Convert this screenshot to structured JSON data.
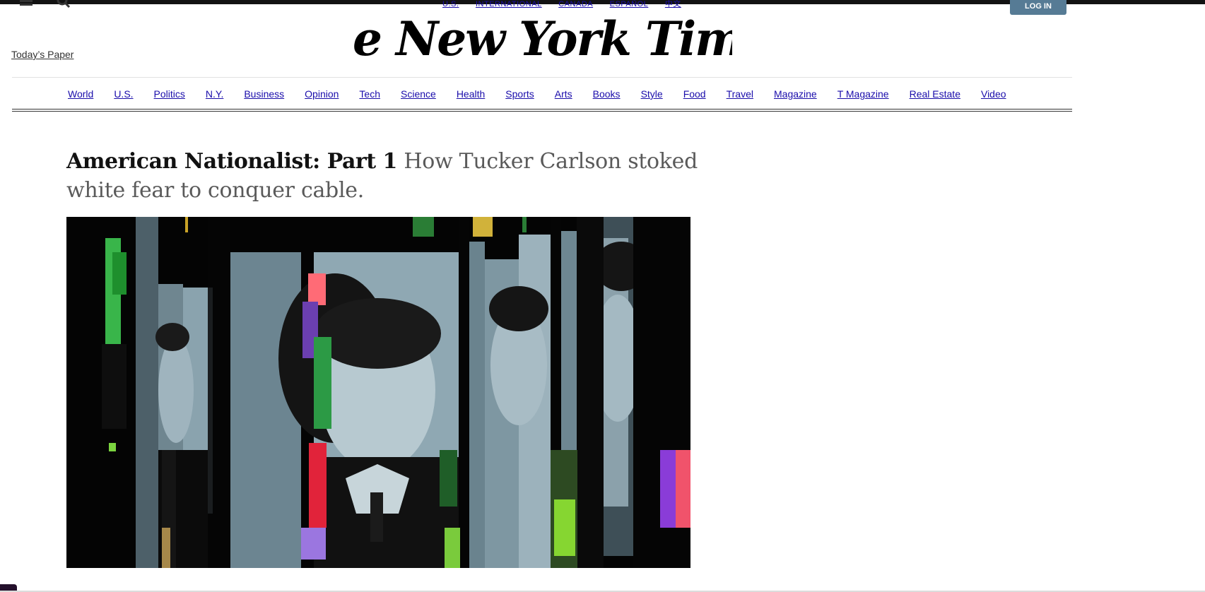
{
  "header": {
    "editions": [
      "U.S.",
      "INTERNATIONAL",
      "CANADA",
      "ESPAÑOL",
      "中文"
    ],
    "login_label": "LOG IN",
    "todays_paper": "Today’s Paper",
    "masthead": "The New York Times"
  },
  "nav": {
    "sections": [
      "World",
      "U.S.",
      "Politics",
      "N.Y.",
      "Business",
      "Opinion",
      "Tech",
      "Science",
      "Health",
      "Sports",
      "Arts",
      "Books",
      "Style",
      "Food",
      "Travel",
      "Magazine",
      "T Magazine",
      "Real Estate",
      "Video"
    ]
  },
  "story": {
    "kicker": "American Nationalist: Part 1",
    "summary": "How Tucker Carlson stoked white fear to conquer cable.",
    "image_alt": "Tucker Carlson glitch portrait"
  },
  "colors": {
    "link": "#1a0dab",
    "login_bg": "#567b95",
    "photo_tint": "#9fb4bf"
  }
}
